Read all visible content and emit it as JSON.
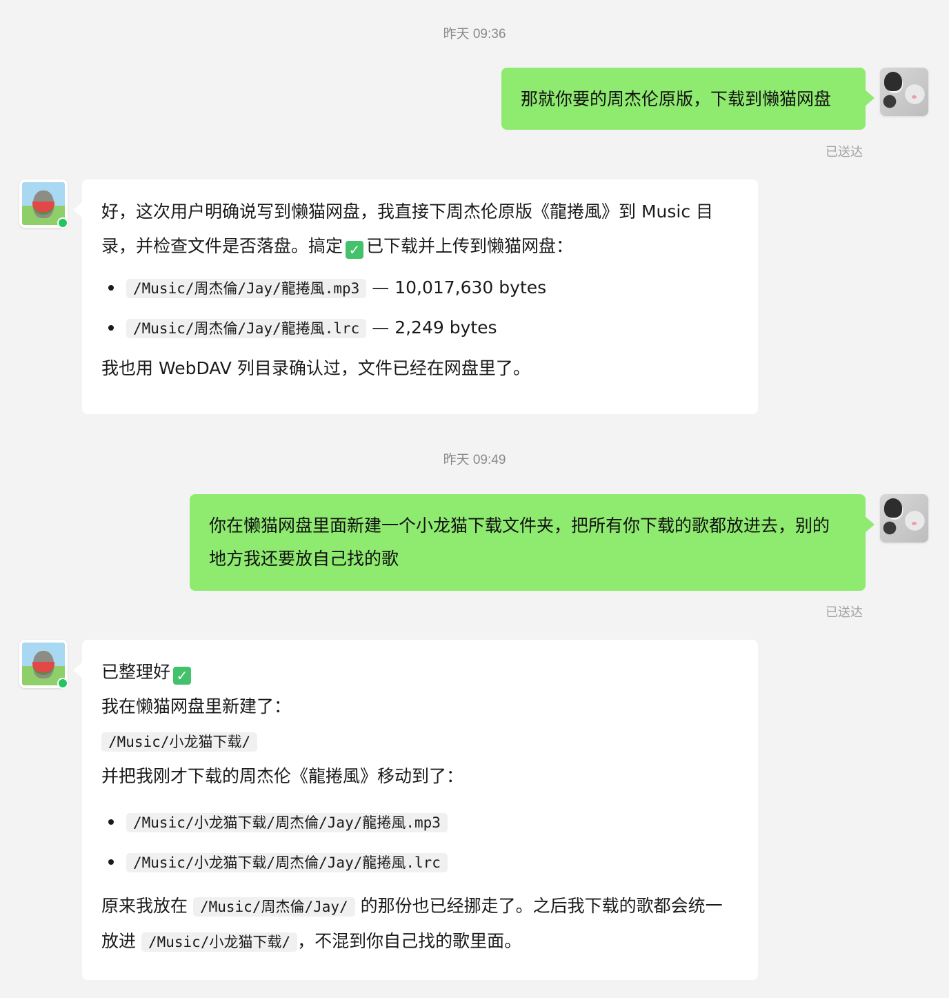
{
  "messages": [
    {
      "timestamp": "昨天 09:36",
      "user_text": "那就你要的周杰伦原版，下载到懒猫网盘",
      "status": "已送达",
      "bot": {
        "intro_1": "好，这次用户明确说写到懒猫网盘，我直接下周杰伦原版《龍捲風》到 Music 目录，并检查文件是否落盘。搞定",
        "intro_2": "已下载并上传到懒猫网盘：",
        "files": [
          {
            "path": "/Music/周杰倫/Jay/龍捲風.mp3",
            "size": "— 10,017,630 bytes"
          },
          {
            "path": "/Music/周杰倫/Jay/龍捲風.lrc",
            "size": "— 2,249 bytes"
          }
        ],
        "outro": "我也用 WebDAV 列目录确认过，文件已经在网盘里了。"
      }
    },
    {
      "timestamp": "昨天 09:49",
      "user_text": "你在懒猫网盘里面新建一个小龙猫下载文件夹，把所有你下载的歌都放进去，别的地方我还要放自己找的歌",
      "status": "已送达",
      "bot": {
        "line_1": "已整理好",
        "line_2": "我在懒猫网盘里新建了：",
        "folder": "/Music/小龙猫下载/",
        "line_3": "并把我刚才下载的周杰伦《龍捲風》移动到了：",
        "files": [
          {
            "path": "/Music/小龙猫下载/周杰倫/Jay/龍捲風.mp3"
          },
          {
            "path": "/Music/小龙猫下载/周杰倫/Jay/龍捲風.lrc"
          }
        ],
        "outro_a": "原来我放在",
        "outro_code_1": "/Music/周杰倫/Jay/",
        "outro_b": "的那份也已经挪走了。之后我下载的歌都会统一放进",
        "outro_code_2": "/Music/小龙猫下载/",
        "outro_c": "，不混到你自己找的歌里面。"
      }
    }
  ],
  "icons": {
    "check": "✓",
    "check_icon_name": "check-mark-icon"
  },
  "colors": {
    "user_bubble": "#8fea70",
    "bot_bubble": "#ffffff",
    "background": "#f3f3f3",
    "online": "#22c55e"
  }
}
